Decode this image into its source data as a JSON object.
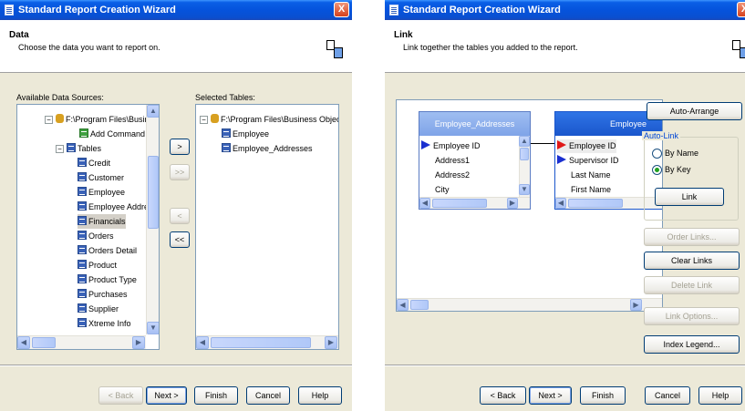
{
  "left": {
    "title": "Standard Report Creation Wizard",
    "close_glyph": "X",
    "header_title": "Data",
    "header_subtitle": "Choose the data you want to report on.",
    "available_label": "Available Data Sources:",
    "selected_label": "Selected Tables:",
    "tree": [
      {
        "label": "F:\\Program Files\\Business O"
      },
      {
        "label": "Add Command"
      },
      {
        "label": "Tables"
      },
      {
        "label": "Credit"
      },
      {
        "label": "Customer"
      },
      {
        "label": "Employee"
      },
      {
        "label": "Employee Addresses"
      },
      {
        "label": "Financials"
      },
      {
        "label": "Orders"
      },
      {
        "label": "Orders Detail"
      },
      {
        "label": "Product"
      },
      {
        "label": "Product Type"
      },
      {
        "label": "Purchases"
      },
      {
        "label": "Supplier"
      },
      {
        "label": "Xtreme Info"
      }
    ],
    "selected": [
      {
        "label": "F:\\Program Files\\Business Objects\\Cry"
      },
      {
        "label": "Employee"
      },
      {
        "label": "Employee_Addresses"
      }
    ],
    "move": {
      "add_one": ">",
      "add_all": ">>",
      "remove_one": "<",
      "remove_all": "<<"
    },
    "buttons": {
      "back": "< Back",
      "next": "Next >",
      "finish": "Finish",
      "cancel": "Cancel",
      "help": "Help"
    }
  },
  "right": {
    "title": "Standard Report Creation Wizard",
    "header_title": "Link",
    "header_subtitle": "Link together the tables you added to the report.",
    "table1": {
      "name": "Employee_Addresses",
      "fields": [
        "Employee ID",
        "Address1",
        "Address2",
        "City"
      ]
    },
    "table2": {
      "name": "Employee",
      "fields": [
        "Employee ID",
        "Supervisor ID",
        "Last Name",
        "First Name"
      ]
    },
    "auto_arrange": "Auto-Arrange",
    "auto_link_label": "Auto-Link",
    "by_name": "By Name",
    "by_key": "By Key",
    "link": "Link",
    "order_links": "Order Links...",
    "clear_links": "Clear Links",
    "delete_link": "Delete Link",
    "link_options": "Link Options...",
    "index_legend": "Index Legend...",
    "buttons": {
      "back": "< Back",
      "next": "Next >",
      "finish": "Finish",
      "cancel": "Cancel",
      "help": "Help"
    }
  }
}
